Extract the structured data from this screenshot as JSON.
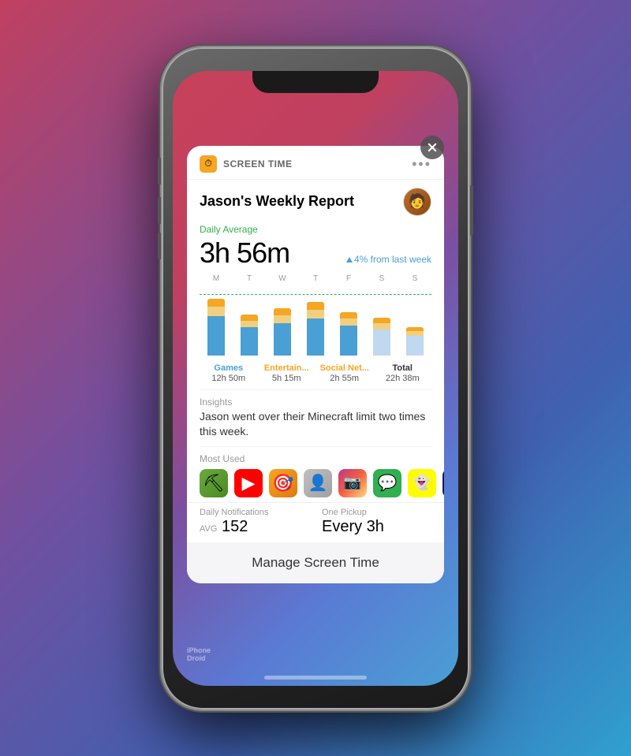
{
  "page": {
    "bg_gradient": "linear-gradient(135deg, #c04060, #7050a0, #4060b0, #30a0d0)"
  },
  "widget": {
    "app_icon": "⏱",
    "title": "SCREEN TIME",
    "more_icon": "•••",
    "report_title": "Jason's Weekly Report",
    "daily_label": "Daily Average",
    "daily_time": "3h 56m",
    "daily_change": "4% from last week",
    "days": [
      "M",
      "T",
      "W",
      "T",
      "F",
      "S",
      "S"
    ],
    "categories": [
      {
        "name": "Games",
        "color": "blue",
        "time": "12h 50m"
      },
      {
        "name": "Entertain...",
        "color": "orange",
        "time": "5h 15m"
      },
      {
        "name": "Social Net...",
        "color": "orange",
        "time": "2h 55m"
      },
      {
        "name": "Total",
        "color": "black",
        "time": "22h 38m"
      }
    ],
    "insights_label": "Insights",
    "insights_text": "Jason went over their Minecraft limit two times this week.",
    "most_used_label": "Most Used",
    "apps": [
      {
        "name": "Minecraft",
        "emoji": "⛏"
      },
      {
        "name": "YouTube",
        "emoji": "▶"
      },
      {
        "name": "Game",
        "emoji": "🎮"
      },
      {
        "name": "Photos",
        "emoji": "👤"
      },
      {
        "name": "Instagram",
        "emoji": "📷"
      },
      {
        "name": "Messages",
        "emoji": "💬"
      },
      {
        "name": "Snapchat",
        "emoji": "👻"
      },
      {
        "name": "TV",
        "emoji": "📺"
      }
    ],
    "notifications_label": "Daily Notifications",
    "notifications_prefix": "AVG",
    "notifications_value": "152",
    "pickup_label": "One Pickup",
    "pickup_value": "Every 3h",
    "manage_button": "Manage Screen Time"
  },
  "watermark": "iPhone\nDroid"
}
